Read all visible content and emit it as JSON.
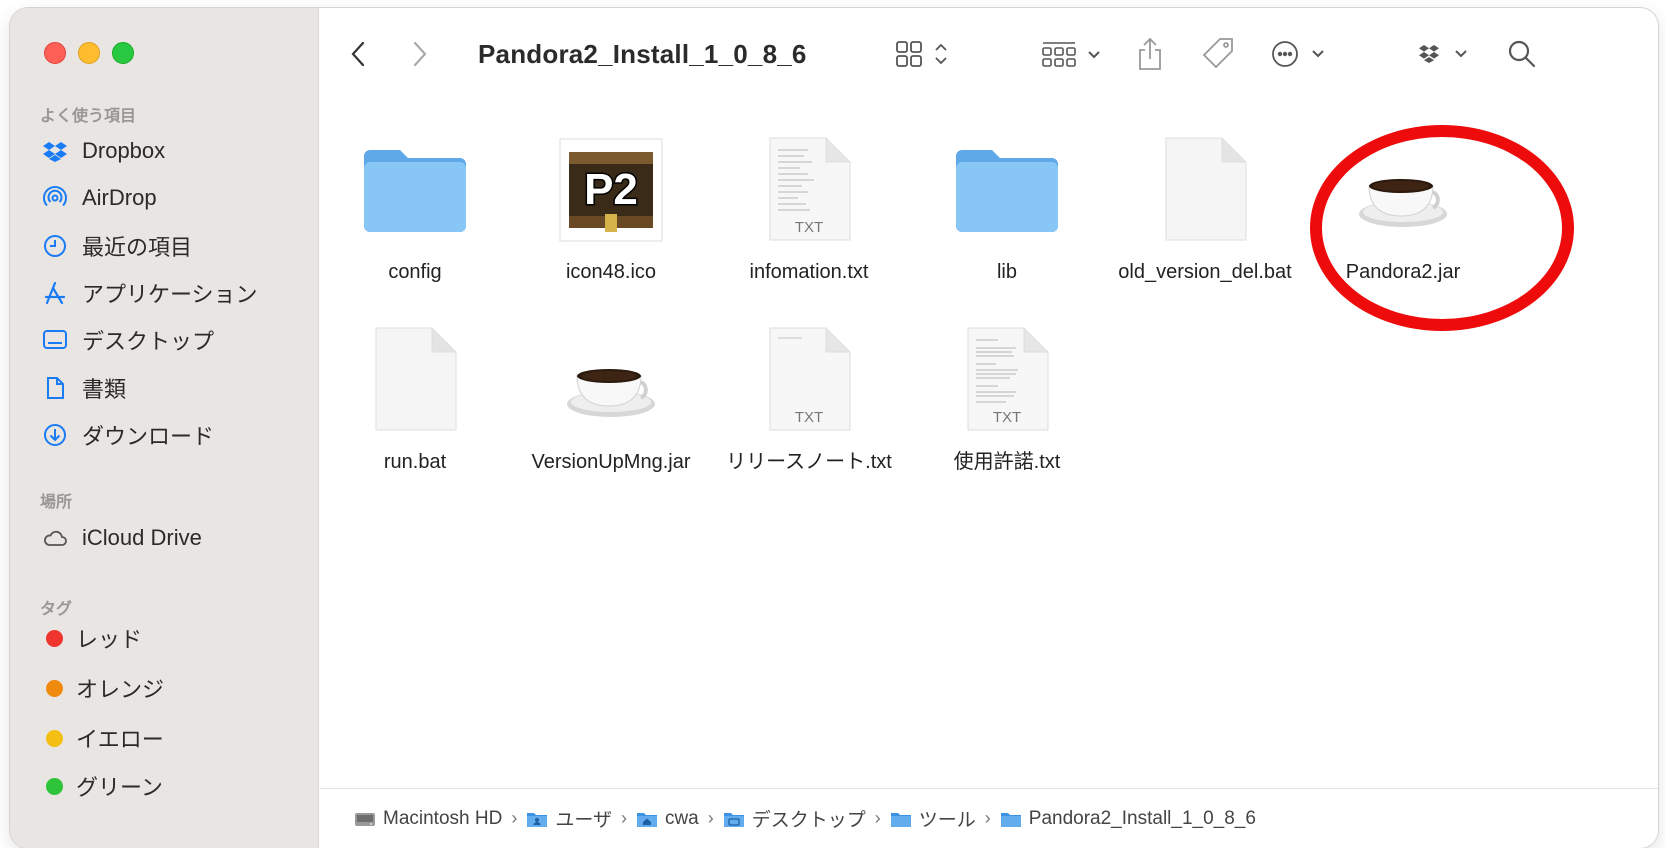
{
  "window": {
    "title": "Pandora2_Install_1_0_8_6"
  },
  "sidebar": {
    "favorites_header": "よく使う項目",
    "favorites": [
      {
        "label": "Dropbox",
        "icon": "dropbox-icon"
      },
      {
        "label": "AirDrop",
        "icon": "airdrop-icon"
      },
      {
        "label": "最近の項目",
        "icon": "clock-icon"
      },
      {
        "label": "アプリケーション",
        "icon": "applications-icon"
      },
      {
        "label": "デスクトップ",
        "icon": "desktop-icon"
      },
      {
        "label": "書類",
        "icon": "document-icon"
      },
      {
        "label": "ダウンロード",
        "icon": "download-icon"
      }
    ],
    "locations_header": "場所",
    "locations": [
      {
        "label": "iCloud Drive",
        "icon": "cloud-icon"
      }
    ],
    "tags_header": "タグ",
    "tags": [
      {
        "label": "レッド",
        "color": "#f0352f"
      },
      {
        "label": "オレンジ",
        "color": "#f08a0c"
      },
      {
        "label": "イエロー",
        "color": "#f2bf12"
      },
      {
        "label": "グリーン",
        "color": "#2ec43a"
      }
    ]
  },
  "files": [
    {
      "name": "config",
      "kind": "folder"
    },
    {
      "name": "icon48.ico",
      "kind": "ico"
    },
    {
      "name": "infomation.txt",
      "kind": "txt"
    },
    {
      "name": "lib",
      "kind": "folder"
    },
    {
      "name": "old_version_del.bat",
      "kind": "blank"
    },
    {
      "name": "Pandora2.jar",
      "kind": "jar"
    },
    {
      "name": "run.bat",
      "kind": "blank"
    },
    {
      "name": "VersionUpMng.jar",
      "kind": "jar"
    },
    {
      "name": "リリースノート.txt",
      "kind": "txt"
    },
    {
      "name": "使用許諾.txt",
      "kind": "txt"
    }
  ],
  "icon_labels": {
    "txt_badge": "TXT",
    "ico_badge": "P2"
  },
  "pathbar": {
    "crumbs": [
      {
        "label": "Macintosh HD",
        "icon": "harddisk-icon"
      },
      {
        "label": "ユーザ",
        "icon": "users-folder-icon"
      },
      {
        "label": "cwa",
        "icon": "home-folder-icon"
      },
      {
        "label": "デスクトップ",
        "icon": "desktop-folder-icon"
      },
      {
        "label": "ツール",
        "icon": "folder-icon"
      },
      {
        "label": "Pandora2_Install_1_0_8_6",
        "icon": "folder-icon"
      }
    ],
    "separator": "›"
  },
  "colors": {
    "accent": "#1a7cf5",
    "sidebar_bg": "#e9e5e3",
    "annotation": "#ee0b0b"
  }
}
